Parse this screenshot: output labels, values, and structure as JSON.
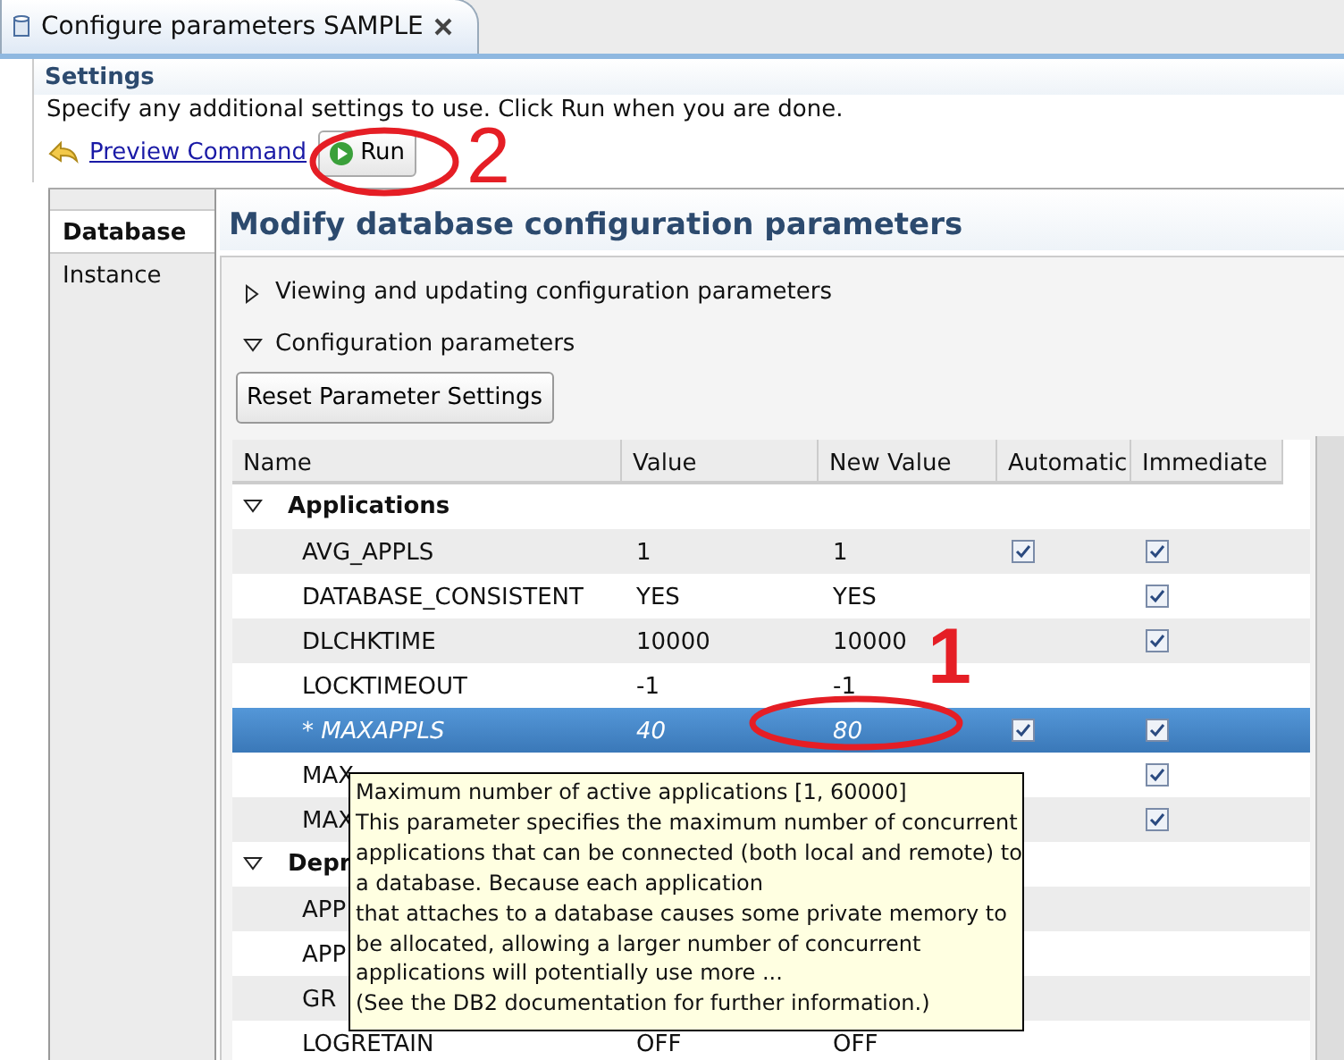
{
  "tab": {
    "title": "Configure parameters SAMPLE"
  },
  "settings": {
    "title": "Settings",
    "description": "Specify any additional settings to use. Click Run when you are done.",
    "preview_link": "Preview Command",
    "run_button": "Run"
  },
  "side_tabs": [
    {
      "label": "Database",
      "selected": true
    },
    {
      "label": "Instance",
      "selected": false
    }
  ],
  "heading": "Modify database configuration parameters",
  "sections": [
    {
      "title": "Viewing and updating configuration parameters",
      "expanded": false
    },
    {
      "title": "Configuration parameters",
      "expanded": true
    }
  ],
  "reset_button": "Reset Parameter Settings",
  "table": {
    "columns": [
      "Name",
      "Value",
      "New Value",
      "Automatic",
      "Immediate"
    ],
    "rows": [
      {
        "kind": "group",
        "name": "Applications",
        "expanded": true,
        "selected": false
      },
      {
        "kind": "param",
        "name": "AVG_APPLS",
        "value": "1",
        "new_value": "1",
        "automatic": true,
        "immediate": true,
        "modified": false,
        "selected": false
      },
      {
        "kind": "param",
        "name": "DATABASE_CONSISTENT",
        "value": "YES",
        "new_value": "YES",
        "automatic": false,
        "immediate": true,
        "modified": false,
        "selected": false
      },
      {
        "kind": "param",
        "name": "DLCHKTIME",
        "value": "10000",
        "new_value": "10000",
        "automatic": false,
        "immediate": true,
        "modified": false,
        "selected": false
      },
      {
        "kind": "param",
        "name": "LOCKTIMEOUT",
        "value": "-1",
        "new_value": "-1",
        "automatic": false,
        "immediate": false,
        "modified": false,
        "selected": false
      },
      {
        "kind": "param",
        "name": "* MAXAPPLS",
        "value": "40",
        "new_value": "80",
        "automatic": true,
        "immediate": true,
        "modified": true,
        "selected": true
      },
      {
        "kind": "param",
        "name": "MAX",
        "automatic": false,
        "immediate": true,
        "modified": false,
        "selected": false
      },
      {
        "kind": "param",
        "name": "MAX",
        "automatic": false,
        "immediate": true,
        "modified": false,
        "selected": false
      },
      {
        "kind": "group",
        "name": "Depr",
        "expanded": true,
        "selected": false
      },
      {
        "kind": "param",
        "name": "APP",
        "automatic": false,
        "immediate": false,
        "modified": false,
        "selected": false
      },
      {
        "kind": "param",
        "name": "APP",
        "automatic": false,
        "immediate": false,
        "modified": false,
        "selected": false
      },
      {
        "kind": "param",
        "name": "GR",
        "automatic": false,
        "immediate": false,
        "modified": false,
        "selected": false
      },
      {
        "kind": "param",
        "name": "LOGRETAIN",
        "value": "OFF",
        "new_value": "OFF",
        "automatic": false,
        "immediate": false,
        "modified": false,
        "selected": false
      }
    ]
  },
  "tooltip": {
    "text": "Maximum number of active applications [1, 60000]\nThis parameter specifies the maximum number of concurrent\napplications that can be connected (both local and remote) to\na database. Because each application\nthat attaches to a database causes some private memory to\nbe allocated, allowing a larger number of concurrent\napplications will potentially use more ...\n(See the DB2 documentation for further information.)"
  },
  "annotations": [
    {
      "label": "2"
    },
    {
      "label": "1"
    }
  ]
}
